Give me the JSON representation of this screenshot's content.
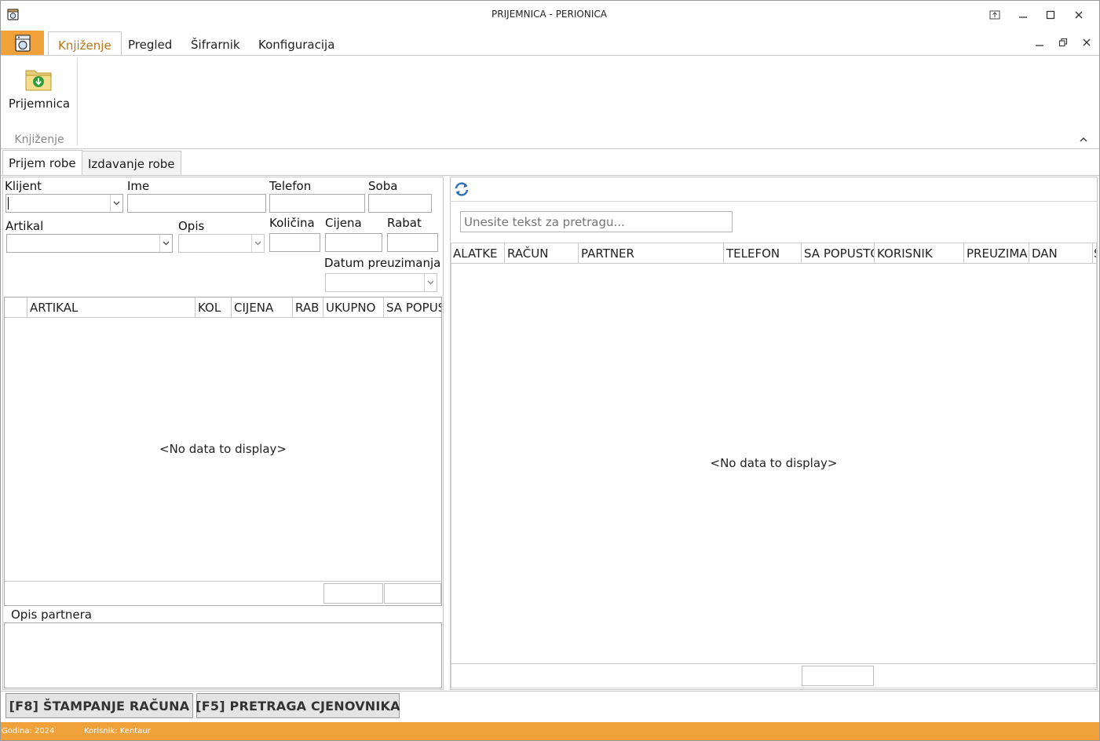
{
  "window": {
    "title": "PRIJEMNICA - PERIONICA",
    "buttons": [
      "pin",
      "minimize",
      "maximize",
      "close"
    ]
  },
  "ribbon": {
    "tabs": [
      {
        "label": "Knjiženje",
        "active": true
      },
      {
        "label": "Pregled",
        "active": false
      },
      {
        "label": "Šifrarnik",
        "active": false
      },
      {
        "label": "Konfiguracija",
        "active": false
      }
    ],
    "groups": [
      {
        "label": "Knjiženje",
        "buttons": [
          {
            "label": "Prijemnica",
            "icon": "folder-download-icon"
          }
        ]
      }
    ],
    "accent_color": "#f0a13a"
  },
  "doc_tabs": [
    {
      "label": "Prijem robe",
      "active": true
    },
    {
      "label": "Izdavanje robe",
      "active": false
    }
  ],
  "form": {
    "klijent_label": "Klijent",
    "ime_label": "Ime",
    "telefon_label": "Telefon",
    "soba_label": "Soba",
    "artikal_label": "Artikal",
    "opis_label": "Opis",
    "kolicina_label": "Količina",
    "cijena_label": "Cijena",
    "rabat_label": "Rabat",
    "datum_label": "Datum preuzimanja",
    "klijent_value": "",
    "ime_value": "",
    "telefon_value": "",
    "soba_value": "",
    "artikal_value": "",
    "opis_value": "",
    "kolicina_value": "",
    "cijena_value": "",
    "rabat_value": "",
    "datum_value": ""
  },
  "items_grid": {
    "columns": [
      "",
      "ARTIKAL",
      "KOL",
      "CIJENA",
      "RAB",
      "UKUPNO",
      "SA POPUS"
    ],
    "empty_text": "<No data to display>"
  },
  "opis_partnera": {
    "label": "Opis partnera",
    "value": ""
  },
  "right_panel": {
    "search_placeholder": "Unesite tekst za pretragu...",
    "columns": [
      "ALATKE",
      "RAČUN",
      "PARTNER",
      "TELEFON",
      "SA POPUSTO",
      "KORISNIK",
      "PREUZIMA",
      "DAN",
      "S"
    ],
    "empty_text": "<No data to display>"
  },
  "commands": {
    "print": "[F8] ŠTAMPANJE RAČUNA",
    "search": "[F5] PRETRAGA CJENOVNIKA"
  },
  "status": {
    "year": "Godina: 2024",
    "user": "Korisnik: Kentaur"
  }
}
